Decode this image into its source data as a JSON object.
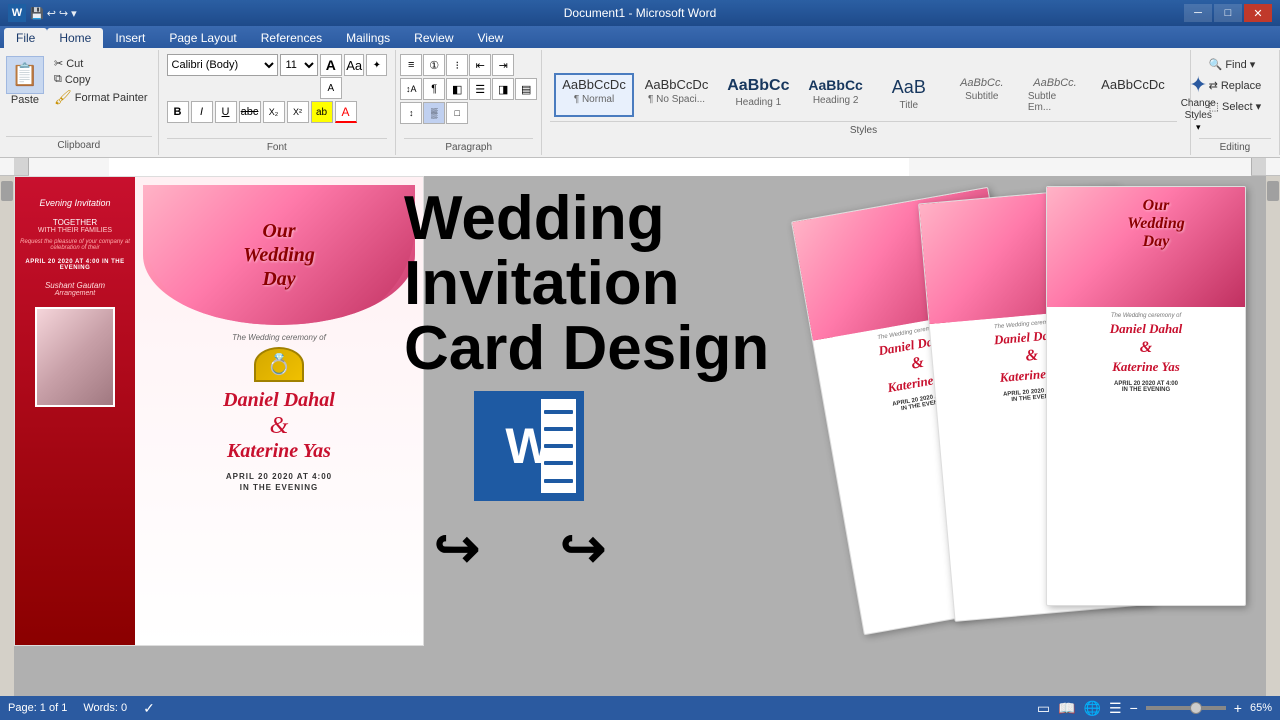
{
  "titlebar": {
    "title": "Document1 - Microsoft Word",
    "minimize": "─",
    "maximize": "□",
    "close": "✕",
    "quickaccess": [
      "💾",
      "↩",
      "↪"
    ]
  },
  "tabs": {
    "items": [
      "File",
      "Home",
      "Insert",
      "Page Layout",
      "References",
      "Mailings",
      "Review",
      "View"
    ],
    "active": "Home"
  },
  "ribbon": {
    "clipboard": {
      "label": "Clipboard",
      "paste": "Paste",
      "cut": "Cut",
      "copy": "Copy",
      "format_painter": "Format Painter"
    },
    "font": {
      "label": "Font",
      "name": "Calibri (Body)",
      "size": "11",
      "bold": "B",
      "italic": "I",
      "underline": "U",
      "strikethrough": "abc",
      "subscript": "X₂",
      "superscript": "X²",
      "clear": "A",
      "text_color": "A",
      "highlight": "ab"
    },
    "paragraph": {
      "label": "Paragraph"
    },
    "styles": {
      "label": "Styles",
      "items": [
        {
          "preview": "AaBbCcDc",
          "label": "¶ Normal",
          "active": true
        },
        {
          "preview": "AaBbCcDc",
          "label": "¶ No Spaci..."
        },
        {
          "preview": "AaBbCc",
          "label": "Heading 1"
        },
        {
          "preview": "AaBbCc",
          "label": "Heading 2"
        },
        {
          "preview": "AaB",
          "label": "Title"
        },
        {
          "preview": "AaBbCc.",
          "label": "Subtitle"
        },
        {
          "preview": "AaBbCc.",
          "label": "Subtle Em..."
        },
        {
          "preview": "AaBbCcDc",
          "label": ""
        }
      ],
      "change_styles": "Change\nStyles"
    },
    "editing": {
      "label": "Editing",
      "find": "Find",
      "replace": "Replace",
      "select": "Select"
    }
  },
  "thumbnail": {
    "main_title_line1": "Wedding",
    "main_title_line2": "Invitation",
    "main_title_line3": "Card Design",
    "left_card": {
      "flowers_text": "Our\nWedding\nDay",
      "evening": "Evening Invitation",
      "together": "TOGETHER",
      "families": "WITH THEIR FAMILIES",
      "request": "Request the pleasure of your company at celebration of their",
      "date1": "APRIL 20 2020 AT 4:00 IN THE EVENING",
      "groom": "Sushant Gautam",
      "arrangement": "Arrangement",
      "ceremony": "The Wedding ceremony of",
      "name1": "Daniel Dahal",
      "ampersand": "&",
      "name2": "Katerine Yas",
      "date2": "APRIL 20 2020 AT 4:00",
      "date2b": "IN THE EVENING"
    },
    "right_cards": {
      "name1": "Daniel Dahal",
      "ampersand": "&",
      "name2": "Katerine Yas",
      "date": "APRIL 20 2020 AT 4:00",
      "date2": "IN THE EVENING"
    }
  },
  "statusbar": {
    "page": "Page: 1 of 1",
    "words": "Words: 0",
    "zoom": "65%"
  }
}
